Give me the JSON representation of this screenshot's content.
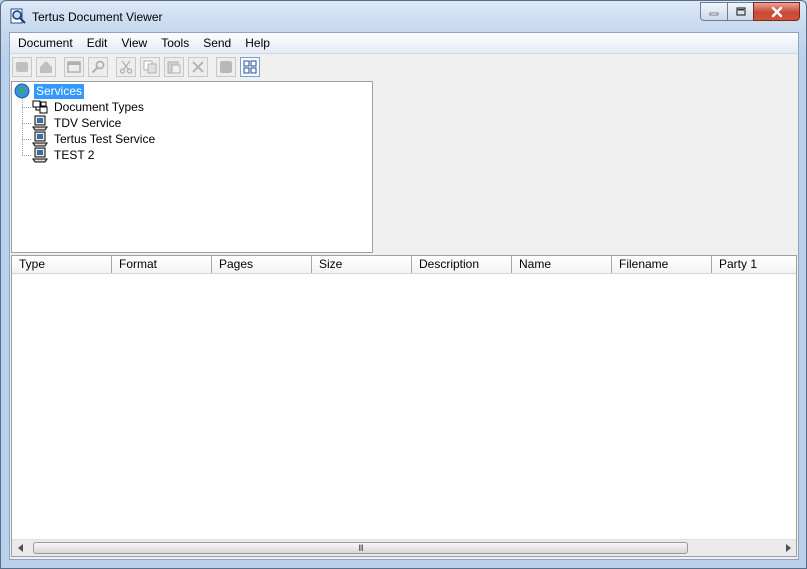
{
  "window": {
    "title": "Tertus Document Viewer",
    "icons": {
      "app": "magnifier-document-icon",
      "minimize": "minimize-icon",
      "maximize": "maximize-icon",
      "close": "close-icon"
    }
  },
  "menu": {
    "items": [
      "Document",
      "Edit",
      "View",
      "Tools",
      "Send",
      "Help"
    ]
  },
  "toolbar": {
    "buttons": [
      "new-icon",
      "home-icon",
      "window-icon",
      "search-icon",
      "cut-icon",
      "copy-icon",
      "paste-icon",
      "delete-icon",
      "properties-icon",
      "thumbnails-icon"
    ]
  },
  "tree": {
    "root": {
      "label": "Services",
      "icon": "globe-icon"
    },
    "children": [
      {
        "label": "Document Types",
        "icon": "document-types-icon"
      },
      {
        "label": "TDV Service",
        "icon": "computer-icon"
      },
      {
        "label": "Tertus Test Service",
        "icon": "computer-icon"
      },
      {
        "label": "TEST 2",
        "icon": "computer-icon"
      }
    ]
  },
  "list": {
    "columns": [
      "Type",
      "Format",
      "Pages",
      "Size",
      "Description",
      "Name",
      "Filename",
      "Party 1"
    ],
    "rows": []
  },
  "scrollbar": {
    "grip": "III"
  },
  "colors": {
    "selection": "#3399ff",
    "close_button": "#c74a35",
    "title_gradient": "#c6d8ee"
  }
}
